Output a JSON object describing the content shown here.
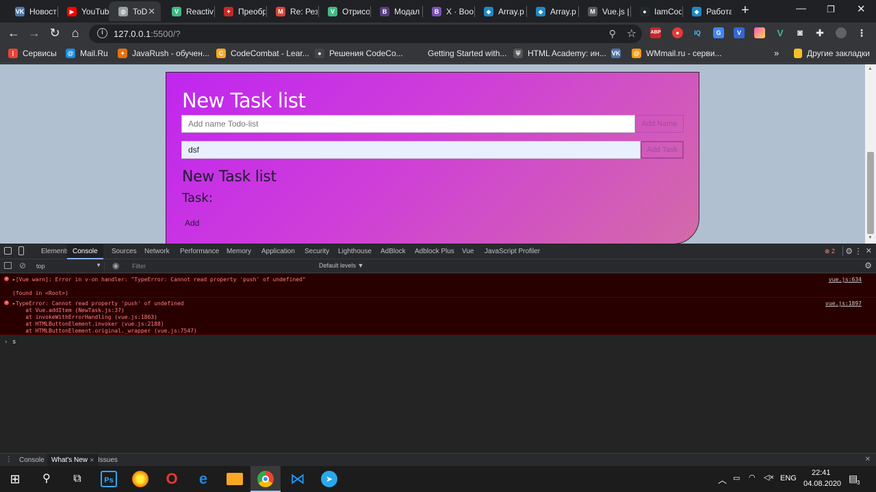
{
  "tabs": [
    {
      "title": "Новост",
      "icon": "vk-icon",
      "color": "#4a76a8",
      "glyph": "VK"
    },
    {
      "title": "YouTub",
      "icon": "youtube-icon",
      "color": "#ff0000",
      "glyph": "▶"
    },
    {
      "title": "ToD",
      "icon": "globe-icon",
      "color": "#9aa0a6",
      "glyph": "◍"
    },
    {
      "title": "Reactiv",
      "icon": "vue-icon",
      "color": "#41b883",
      "glyph": "V"
    },
    {
      "title": "Преобр",
      "icon": "javarush-icon",
      "color": "#c62828",
      "glyph": "✦"
    },
    {
      "title": "Re: Рез",
      "icon": "mail-icon",
      "color": "#d44638",
      "glyph": "M"
    },
    {
      "title": "Отрисо",
      "icon": "vue-icon",
      "color": "#41b883",
      "glyph": "V"
    },
    {
      "title": "Модал",
      "icon": "bootstrap-icon",
      "color": "#563d7c",
      "glyph": "B"
    },
    {
      "title": "X · Boot",
      "icon": "bootstrap-icon",
      "color": "#7952b3",
      "glyph": "B"
    },
    {
      "title": "Array.p",
      "icon": "codewars-icon",
      "color": "#1d88c8",
      "glyph": "◆"
    },
    {
      "title": "Array.p",
      "icon": "codewars-icon",
      "color": "#1d88c8",
      "glyph": "◆"
    },
    {
      "title": "Vue.js |",
      "icon": "medium-icon",
      "color": "#555a60",
      "glyph": "M"
    },
    {
      "title": "IamCod",
      "icon": "github-icon",
      "color": "#24292e",
      "glyph": "●"
    },
    {
      "title": "Работа",
      "icon": "codewars-icon",
      "color": "#1d88c8",
      "glyph": "◆"
    }
  ],
  "address": {
    "host": "127.0.0.1",
    "rest": ":5500/?"
  },
  "bookmarks": [
    {
      "label": "Сервисы",
      "icon": "apps-icon",
      "color": "#ea4335",
      "glyph": "⋮"
    },
    {
      "label": "Mail.Ru",
      "icon": "mailru-icon",
      "color": "#168de2",
      "glyph": "@"
    },
    {
      "label": "JavaRush - обучен...",
      "icon": "javarush-icon",
      "color": "#e8710a",
      "glyph": "✦"
    },
    {
      "label": "CodeCombat - Lear...",
      "icon": "codecombat-icon",
      "color": "#f9a825",
      "glyph": "C"
    },
    {
      "label": "Решения CodeCo...",
      "icon": "github-icon",
      "color": "#444",
      "glyph": "●"
    },
    {
      "label": "Getting Started with...",
      "icon": "blank-icon",
      "color": "#35363a",
      "glyph": ""
    },
    {
      "label": "HTML Academy: ин...",
      "icon": "shield-icon",
      "color": "#555",
      "glyph": "⛨"
    },
    {
      "label": "",
      "icon": "vk-icon",
      "color": "#4a76a8",
      "glyph": "VK"
    },
    {
      "label": "WMmail.ru - серви...",
      "icon": "wmmail-icon",
      "color": "#f39c12",
      "glyph": "@"
    }
  ],
  "other_bookmarks": "Другие закладки",
  "card": {
    "title": "New Task list",
    "list_placeholder": "Add name Todo-list",
    "add_name_label": "Add Name",
    "task_value": "dsf",
    "add_task_label": "Add Task",
    "subtitle": "New Task list",
    "task_label": "Task:",
    "add_label": "Add"
  },
  "devtools": {
    "tabs": [
      "Elements",
      "Console",
      "Sources",
      "Network",
      "Performance",
      "Memory",
      "Application",
      "Security",
      "Lighthouse",
      "AdBlock",
      "Adblock Plus",
      "Vue",
      "JavaScript Profiler"
    ],
    "active_tab": "Console",
    "error_count": "2",
    "context": "top",
    "filter_placeholder": "Filter",
    "levels": "Default levels ▼",
    "errors": [
      {
        "lines": [
          "▸[Vue warn]: Error in v-on handler: \"TypeError: Cannot read property 'push' of undefined\"",
          "",
          "(found in <Root>)"
        ],
        "source": "vue.js:634"
      },
      {
        "lines": [
          "▸TypeError: Cannot read property 'push' of undefined",
          "    at Vue.addItem (NewTask.js:37)",
          "    at invokeWithErrorHandling (vue.js:1863)",
          "    at HTMLButtonElement.invoker (vue.js:2188)",
          "    at HTMLButtonElement.original._wrapper (vue.js:7547)"
        ],
        "source": "vue.js:1897"
      }
    ],
    "prompt_text": "s",
    "drawer_tabs": [
      "Console",
      "What's New",
      "Issues"
    ]
  },
  "taskbar": {
    "lang": "ENG",
    "time": "22:41",
    "date": "04.08.2020",
    "notifications": "3"
  }
}
